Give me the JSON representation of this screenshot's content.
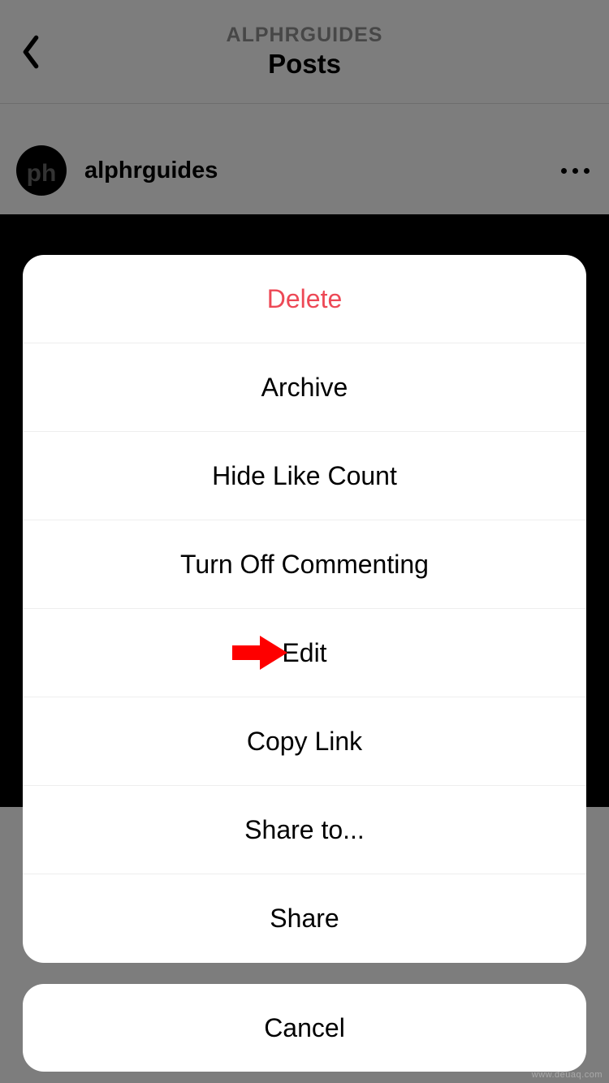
{
  "header": {
    "subtitle": "ALPHRGUIDES",
    "title": "Posts"
  },
  "post": {
    "username": "alphrguides",
    "avatar_text": "ph"
  },
  "action_sheet": {
    "items": [
      {
        "label": "Delete",
        "destructive": true
      },
      {
        "label": "Archive",
        "destructive": false
      },
      {
        "label": "Hide Like Count",
        "destructive": false
      },
      {
        "label": "Turn Off Commenting",
        "destructive": false
      },
      {
        "label": "Edit",
        "destructive": false,
        "highlighted": true
      },
      {
        "label": "Copy Link",
        "destructive": false
      },
      {
        "label": "Share to...",
        "destructive": false
      },
      {
        "label": "Share",
        "destructive": false
      }
    ],
    "cancel_label": "Cancel"
  },
  "colors": {
    "destructive": "#ed4956",
    "arrow": "#fe0000"
  },
  "watermark": "www.deuaq.com"
}
